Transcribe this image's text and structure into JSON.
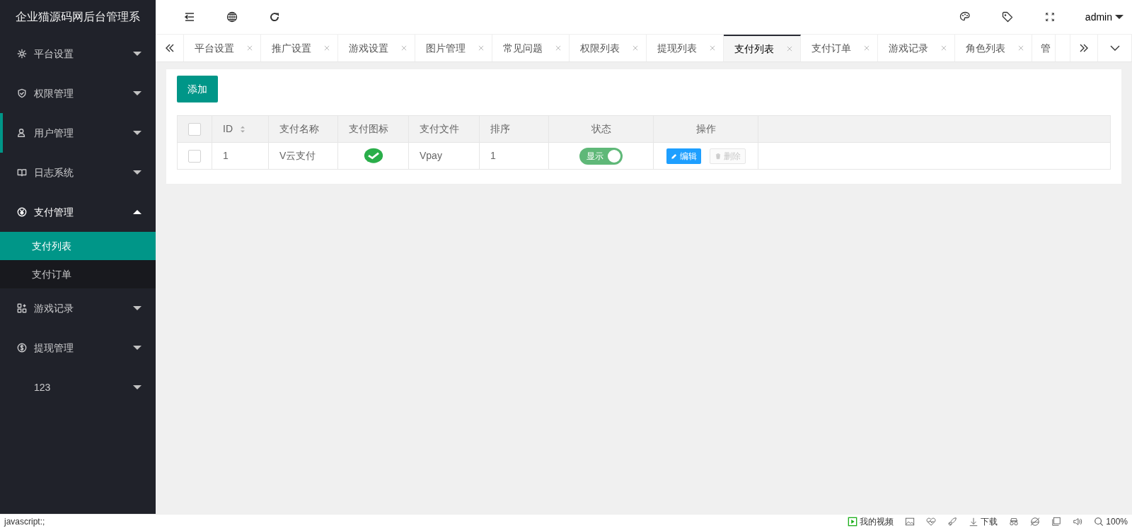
{
  "brand": "企业猫源码网后台管理系",
  "sidebar": {
    "items": [
      {
        "label": "平台设置",
        "expanded": false,
        "hovered": false
      },
      {
        "label": "权限管理",
        "expanded": false,
        "hovered": false
      },
      {
        "label": "用户管理",
        "expanded": false,
        "hovered": true
      },
      {
        "label": "日志系统",
        "expanded": false,
        "hovered": false
      },
      {
        "label": "支付管理",
        "expanded": true,
        "hovered": false,
        "children": [
          {
            "label": "支付列表",
            "selected": true
          },
          {
            "label": "支付订单",
            "selected": false
          }
        ]
      },
      {
        "label": "游戏记录",
        "expanded": false,
        "hovered": false
      },
      {
        "label": "提现管理",
        "expanded": false,
        "hovered": false
      },
      {
        "label": "123",
        "expanded": false,
        "hovered": false
      }
    ]
  },
  "header": {
    "user": "admin"
  },
  "tabs": [
    {
      "label": "平台设置",
      "selected": false,
      "kind": "full"
    },
    {
      "label": "推广设置",
      "selected": false,
      "kind": "full"
    },
    {
      "label": "游戏设置",
      "selected": false,
      "kind": "full"
    },
    {
      "label": "图片管理",
      "selected": false,
      "kind": "full"
    },
    {
      "label": "常见问题",
      "selected": false,
      "kind": "full"
    },
    {
      "label": "权限列表",
      "selected": false,
      "kind": "full"
    },
    {
      "label": "提现列表",
      "selected": false,
      "kind": "full"
    },
    {
      "label": "支付列表",
      "selected": true,
      "kind": "full"
    },
    {
      "label": "支付订单",
      "selected": false,
      "kind": "full"
    },
    {
      "label": "游戏记录",
      "selected": false,
      "kind": "full"
    },
    {
      "label": "角色列表",
      "selected": false,
      "kind": "full"
    },
    {
      "label": "管",
      "selected": false,
      "kind": "partial"
    }
  ],
  "add_button": "添加",
  "table": {
    "select_all_checked": false,
    "columns": [
      "ID",
      "支付名称",
      "支付图标",
      "支付文件",
      "排序",
      "状态",
      "操作"
    ],
    "rows": [
      {
        "checked": false,
        "id": "1",
        "name": "V云支付",
        "file": "Vpay",
        "sort": "1",
        "status": {
          "on": true,
          "text": "显示"
        },
        "edit": "编辑",
        "delete": "删除"
      }
    ]
  },
  "status_bar": {
    "left": "javascript:;",
    "video_label": "我的视频",
    "download_label": "下载",
    "zoom_label": "100%"
  }
}
